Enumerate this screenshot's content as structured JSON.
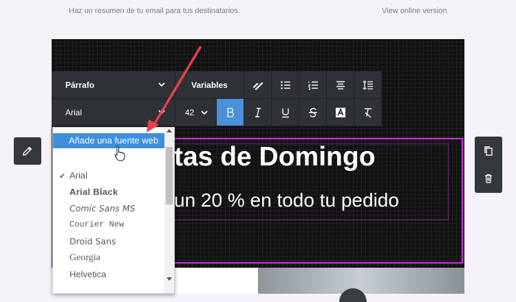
{
  "header": {
    "summary_placeholder": "Haz un resumen de tu email para tus destinatarios.",
    "online_link": "View online version"
  },
  "toolbar": {
    "block_format": "Párrafo",
    "variables_label": "Variables",
    "font_family": "Arial",
    "font_size": "42",
    "icons": [
      "link-icon",
      "bulleted-list-icon",
      "numbered-list-icon",
      "align-center-icon",
      "line-height-icon",
      "bold-icon",
      "italic-icon",
      "underline-icon",
      "strikethrough-icon",
      "text-color-icon",
      "clear-format-icon"
    ],
    "bold_active": true
  },
  "font_dropdown": {
    "add_web_font": "Añade una fuente web",
    "selected": "Arial",
    "fonts": [
      "Arial",
      "Arial Black",
      "Comic Sans MS",
      "Courier New",
      "Droid Sans",
      "Georgia",
      "Helvetica"
    ]
  },
  "content": {
    "headline": "tas de Domingo",
    "subline": "un 20 % en todo tu pedido"
  },
  "side_actions": [
    "edit-icon",
    "duplicate-icon",
    "delete-icon"
  ],
  "colors": {
    "accent_blue": "#3d8fde",
    "selection_border": "#d331e8",
    "toolbar_bg": "#2e3136",
    "annotation_arrow": "#e8414d"
  }
}
